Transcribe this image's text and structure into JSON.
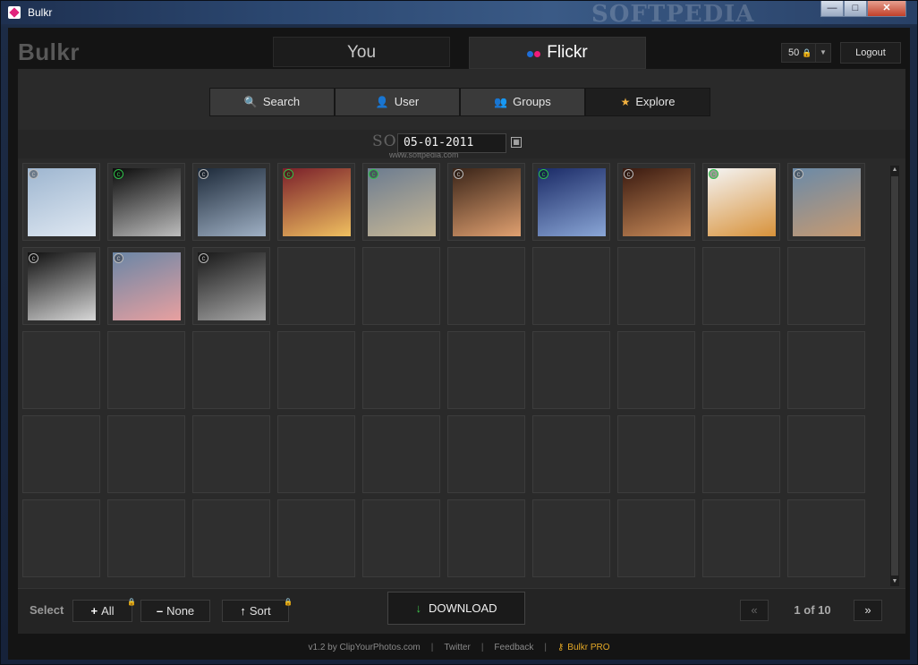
{
  "window": {
    "title": "Bulkr",
    "watermark": "SOFTPEDIA"
  },
  "window_controls": {
    "minimize": "—",
    "maximize": "□",
    "close": "✕"
  },
  "app": {
    "logo": "Bulkr"
  },
  "main_tabs": [
    {
      "label": "You",
      "active": false
    },
    {
      "label": "Flickr",
      "active": true
    }
  ],
  "header": {
    "credits": "50",
    "logout": "Logout"
  },
  "sub_tabs": [
    {
      "label": "Search",
      "icon": "magnifier-icon",
      "active": false
    },
    {
      "label": "User",
      "icon": "user-icon",
      "active": false
    },
    {
      "label": "Groups",
      "icon": "groups-icon",
      "active": false
    },
    {
      "label": "Explore",
      "icon": "star-icon",
      "active": true
    }
  ],
  "date": {
    "value": "05-01-2011",
    "watermark": "SOFTPEDIA",
    "watermark_sub": "www.softpedia.com"
  },
  "grid": {
    "columns": 10,
    "rows": 5,
    "photos": [
      {
        "badge": "c",
        "badge_color": "#bbbbbb",
        "palette": [
          "#9eb6d0",
          "#dfe8f2"
        ]
      },
      {
        "badge": "c",
        "badge_color": "#2ec24a",
        "palette": [
          "#0c0c0c",
          "#bdbdbd"
        ]
      },
      {
        "badge": "c",
        "badge_color": "#bbbbbb",
        "palette": [
          "#1d2a3a",
          "#9fb0c4"
        ]
      },
      {
        "badge": "c",
        "badge_color": "#2ec24a",
        "palette": [
          "#7a1f2a",
          "#f0c060"
        ]
      },
      {
        "badge": "c",
        "badge_color": "#2ec24a",
        "palette": [
          "#6c7c90",
          "#c8b896"
        ]
      },
      {
        "badge": "c",
        "badge_color": "#bbbbbb",
        "palette": [
          "#3a2418",
          "#e0a070"
        ]
      },
      {
        "badge": "c",
        "badge_color": "#2ec24a",
        "palette": [
          "#1a2a66",
          "#8aa6d6"
        ]
      },
      {
        "badge": "c",
        "badge_color": "#bbbbbb",
        "palette": [
          "#3a1a10",
          "#c88a58"
        ]
      },
      {
        "badge": "c",
        "badge_color": "#2ec24a",
        "palette": [
          "#f4f4f4",
          "#d8923a"
        ]
      },
      {
        "badge": "c",
        "badge_color": "#bbbbbb",
        "palette": [
          "#6a8aa8",
          "#c89a70"
        ]
      },
      {
        "badge": "c",
        "badge_color": "#bbbbbb",
        "palette": [
          "#101010",
          "#d8d8d8"
        ]
      },
      {
        "badge": "c",
        "badge_color": "#bbbbbb",
        "palette": [
          "#6a86a6",
          "#e8a0a0"
        ]
      },
      {
        "badge": "c",
        "badge_color": "#bbbbbb",
        "palette": [
          "#181818",
          "#a8a8a8"
        ]
      }
    ]
  },
  "footer": {
    "select_label": "Select",
    "all": "All",
    "none": "None",
    "sort": "Sort",
    "download": "DOWNLOAD",
    "prev": "«",
    "page": "1 of 10",
    "next": "»"
  },
  "bottom": {
    "version": "v1.2 by  ClipYourPhotos.com",
    "twitter": "Twitter",
    "feedback": "Feedback",
    "pro": "Bulkr PRO"
  },
  "colors": {
    "accent_pro": "#e4a826",
    "badge_green": "#2ec24a",
    "download_arrow": "#3ec24a"
  }
}
